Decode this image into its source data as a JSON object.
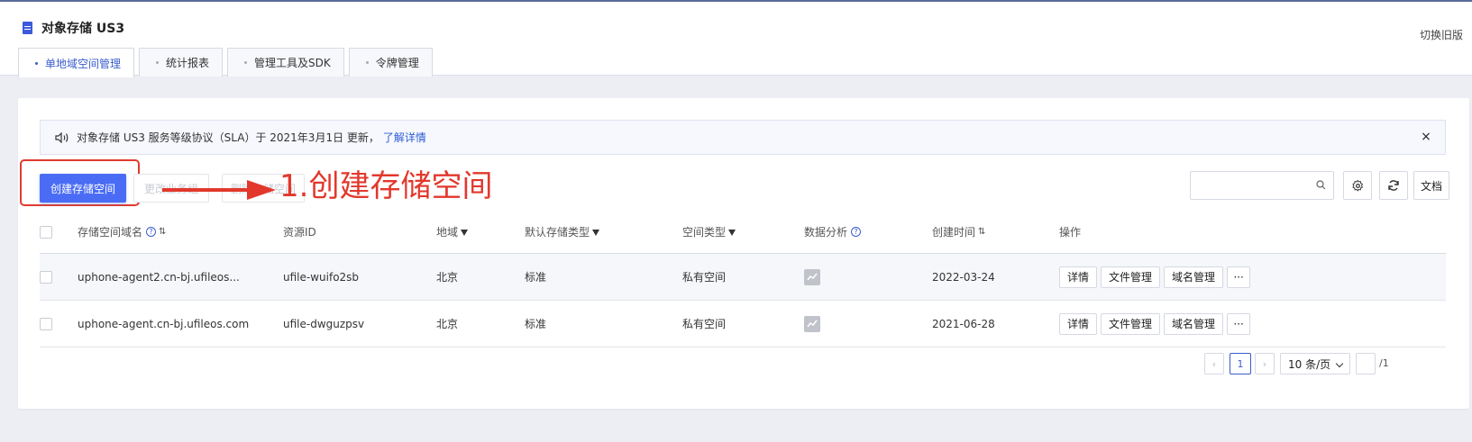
{
  "page": {
    "title": "对象存储 US3",
    "switch_label": "切换旧版"
  },
  "tabs": [
    {
      "label": "单地域空间管理",
      "active": true
    },
    {
      "label": "统计报表",
      "active": false
    },
    {
      "label": "管理工具及SDK",
      "active": false
    },
    {
      "label": "令牌管理",
      "active": false
    }
  ],
  "notice": {
    "text": "对象存储 US3 服务等级协议（SLA）于 2021年3月1日 更新，",
    "link": "了解详情",
    "close": "×"
  },
  "toolbar": {
    "create_label": "创建存储空间",
    "edit_group_label": "更改业务组",
    "delete_label": "删除存储空间",
    "doc_label": "文档",
    "search_placeholder": ""
  },
  "annotation": {
    "text": "1.创建存储空间",
    "color": "#e2382c"
  },
  "table": {
    "headers": {
      "name": "存储空间域名",
      "id": "资源ID",
      "region": "地域",
      "storage": "默认存储类型",
      "type": "空间类型",
      "analysis": "数据分析",
      "created": "创建时间",
      "ops": "操作"
    },
    "rows": [
      {
        "name": "uphone-agent2.cn-bj.ufileos...",
        "id": "ufile-wuifo2sb",
        "region": "北京",
        "storage": "标准",
        "type": "私有空间",
        "created": "2022-03-24"
      },
      {
        "name": "uphone-agent.cn-bj.ufileos.com",
        "id": "ufile-dwguzpsv",
        "region": "北京",
        "storage": "标准",
        "type": "私有空间",
        "created": "2021-06-28"
      }
    ],
    "op_labels": {
      "detail": "详情",
      "files": "文件管理",
      "domain": "域名管理",
      "more": "···"
    }
  },
  "pagination": {
    "prev": "‹",
    "current": "1",
    "next": "›",
    "page_size": "10 条/页",
    "total": "/1"
  },
  "colors": {
    "primary": "#4a6cf5",
    "link": "#2f5bd6",
    "annotation_red": "#e2382c"
  }
}
